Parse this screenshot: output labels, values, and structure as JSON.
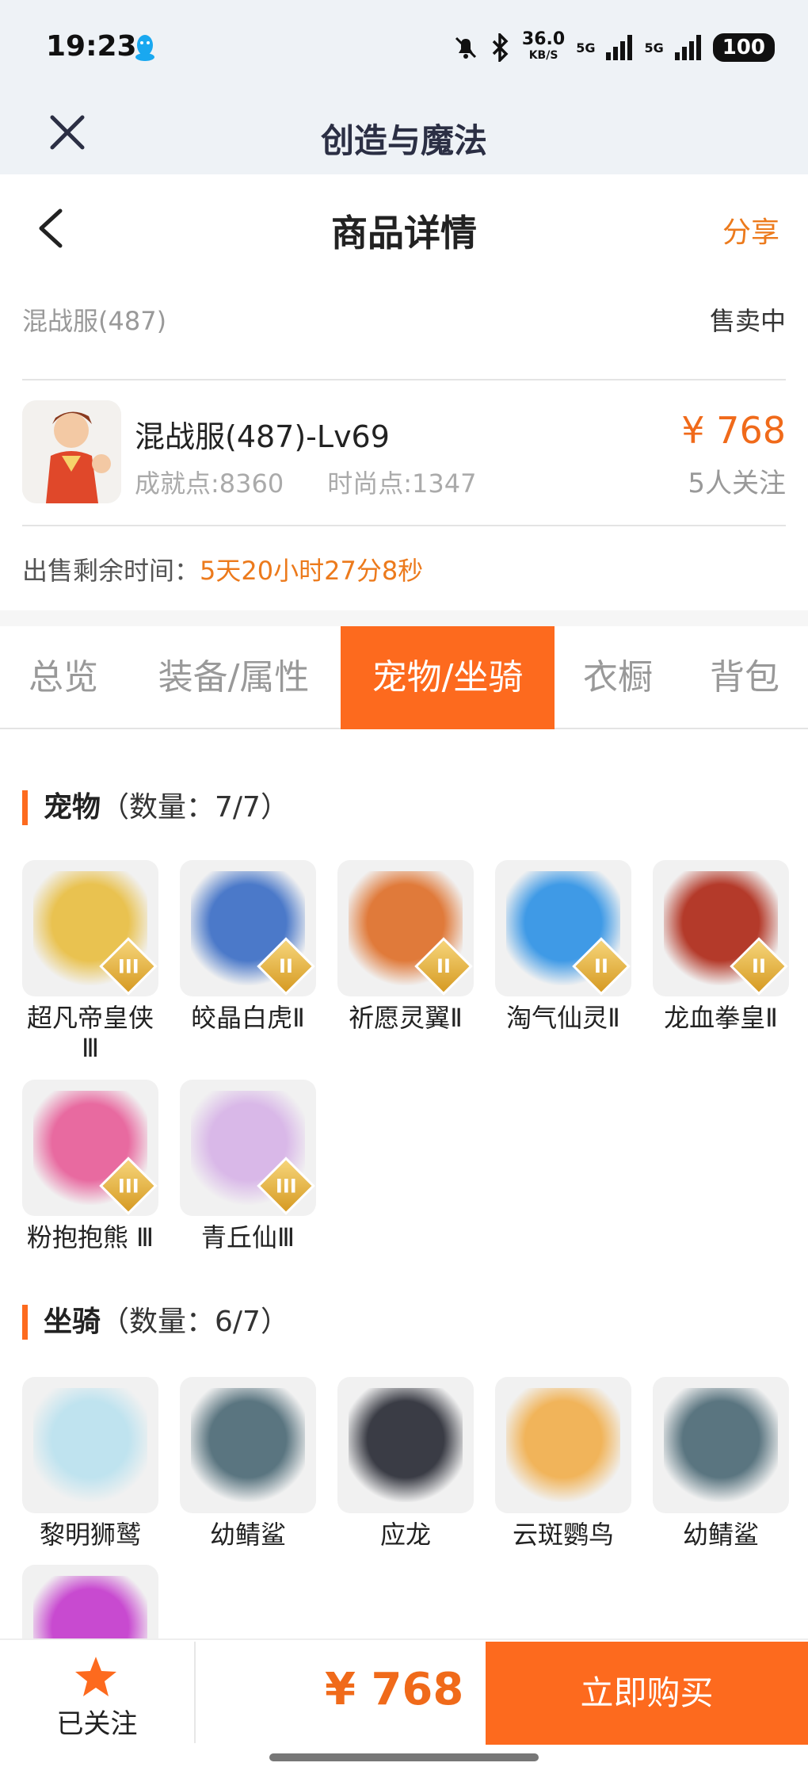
{
  "status": {
    "time": "19:23",
    "speed": "36.0",
    "speed_unit": "KB/S",
    "net1": "5G",
    "net2": "5G",
    "battery": "100"
  },
  "app": {
    "title": "创造与魔法"
  },
  "nav": {
    "title": "商品详情",
    "share": "分享"
  },
  "server": {
    "name": "混战服(487)",
    "status": "售卖中"
  },
  "item": {
    "name": "混战服(487)-Lv69",
    "achievement": "成就点:8360",
    "fashion": "时尚点:1347",
    "price": "¥ 768",
    "followers": "5人关注"
  },
  "remain": {
    "label": "出售剩余时间：",
    "value": "5天20小时27分8秒"
  },
  "tabs": [
    {
      "label": "总览",
      "active": false
    },
    {
      "label": "装备/属性",
      "active": false
    },
    {
      "label": "宠物/坐骑",
      "active": true
    },
    {
      "label": "衣橱",
      "active": false
    },
    {
      "label": "背包",
      "active": false
    }
  ],
  "pets": {
    "title": "宠物",
    "count": "（数量：7/7）",
    "items": [
      {
        "name": "超凡帝皇侠Ⅲ",
        "rank": "III",
        "color": "#e9c250"
      },
      {
        "name": "皎晶白虎Ⅱ",
        "rank": "II",
        "color": "#4b79c9"
      },
      {
        "name": "祈愿灵翼Ⅱ",
        "rank": "II",
        "color": "#e07a3a"
      },
      {
        "name": "淘气仙灵Ⅱ",
        "rank": "II",
        "color": "#3f9ae6"
      },
      {
        "name": "龙血拳皇Ⅱ",
        "rank": "II",
        "color": "#b43a2a"
      },
      {
        "name": "粉抱抱熊 Ⅲ",
        "rank": "III",
        "color": "#e86aa0"
      },
      {
        "name": "青丘仙Ⅲ",
        "rank": "III",
        "color": "#d9b8e8"
      }
    ]
  },
  "mounts": {
    "title": "坐骑",
    "count": "（数量：6/7）",
    "items": [
      {
        "name": "黎明狮鹫",
        "color": "#bfe3ef"
      },
      {
        "name": "幼鲭鲨",
        "color": "#5a7580"
      },
      {
        "name": "应龙",
        "color": "#3a3c45"
      },
      {
        "name": "云斑鹦鸟",
        "color": "#f1b45a"
      },
      {
        "name": "幼鲭鲨",
        "color": "#5a7580"
      },
      {
        "name": "",
        "color": "#c84ad0"
      }
    ]
  },
  "bottom": {
    "follow_label": "已关注",
    "price": "¥ 768",
    "buy_label": "立即购买"
  },
  "colors": {
    "accent": "#fd6a1e",
    "price": "#f06a1a",
    "share": "#ec7a1c"
  }
}
